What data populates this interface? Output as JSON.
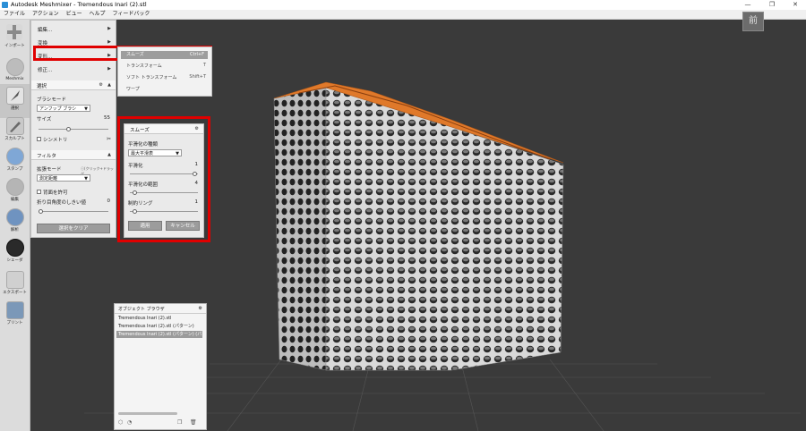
{
  "window": {
    "title": "Autodesk Meshmixer - Tremendous Inari (2).stl",
    "min": "—",
    "max": "❐",
    "close": "✕"
  },
  "menu": [
    "ファイル",
    "アクション",
    "ビュー",
    "ヘルプ",
    "フィードバック"
  ],
  "toolbar": [
    {
      "label": "インポート",
      "icon": "plus-icon"
    },
    {
      "label": "Meshmix",
      "icon": "meshmix-icon"
    },
    {
      "label": "選択",
      "icon": "select-cursor-icon",
      "active": true
    },
    {
      "label": "スカルプト",
      "icon": "brush-icon"
    },
    {
      "label": "スタンプ",
      "icon": "stamp-icon"
    },
    {
      "label": "編集",
      "icon": "edit-icon"
    },
    {
      "label": "解析",
      "icon": "analysis-icon"
    },
    {
      "label": "シェーダ",
      "icon": "shader-icon"
    },
    {
      "label": "エクスポート",
      "icon": "export-icon"
    },
    {
      "label": "プリント",
      "icon": "print-icon"
    }
  ],
  "left_panel": {
    "menu_items": [
      "編集...",
      "変換",
      "変形...",
      "修正..."
    ],
    "selection": {
      "header": "選択",
      "brush_mode_label": "ブラシモード",
      "brush_mode_value": "アンフップ ブラシ",
      "size_label": "サイズ",
      "size_value": "55",
      "size_fraction": 0.42,
      "symmetry_label": "シンメトリ"
    },
    "filter": {
      "header": "フィルタ",
      "expand_mode_label": "拡張モード",
      "expand_hint": "ⓘ(クリック+ドラッグ",
      "expand_mode_value": "測定距離",
      "allow_back_label": "背面を許可",
      "crease_angle_label": "折り目角度のしきい値",
      "crease_angle_value": "0",
      "crease_fraction": 0.0
    },
    "clear_button": "選択をクリア"
  },
  "flyout": {
    "items": [
      {
        "label": "スムーズ",
        "shortcut": "Ctrl+F",
        "highlight": true
      },
      {
        "label": "トランスフォーム",
        "shortcut": "T"
      },
      {
        "label": "ソフト トランスフォーム",
        "shortcut": "Shift+T"
      },
      {
        "label": "ワープ",
        "shortcut": ""
      }
    ]
  },
  "smooth_panel": {
    "header": "スムーズ",
    "type_label": "平滑化の種類",
    "type_value": "最大平滑表",
    "smoothing_label": "平滑化",
    "smoothing_value": "1",
    "smoothing_fraction": 0.98,
    "scale_label": "平滑化の範囲",
    "scale_value": "4",
    "scale_fraction": 0.04,
    "constraint_label": "制約リング",
    "constraint_value": "1",
    "constraint_fraction": 0.04,
    "accept": "適用",
    "cancel": "キャンセル"
  },
  "object_browser": {
    "header": "オブジェクト ブラウザ",
    "items": [
      {
        "label": "Tremendous Inari (2).stl",
        "selected": false
      },
      {
        "label": "Tremendous Inari (2).stl (パターン)",
        "selected": false
      },
      {
        "label": "Tremendous Inari (2).stl (パターン) (パターン)",
        "selected": true
      }
    ]
  },
  "viewcube": {
    "label": "前"
  },
  "colors": {
    "accent_red": "#e00000",
    "mesh_orange": "#e0792a",
    "viewport_bg": "#3a3a3a"
  }
}
